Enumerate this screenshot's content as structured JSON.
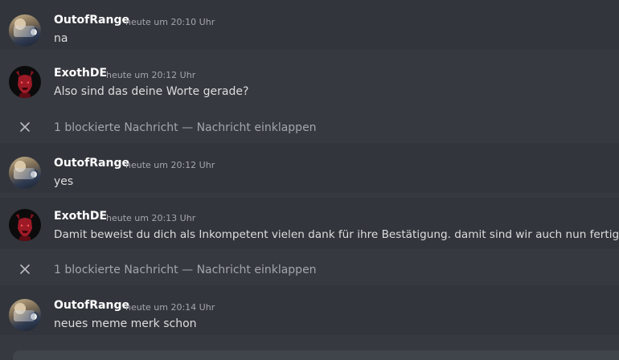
{
  "messages": [
    {
      "author": "OutofRange",
      "time": "heute um 20:10 Uhr",
      "text": "na"
    },
    {
      "author": "ExothDE",
      "time": "heute um 20:12 Uhr",
      "text": "Also sind das deine Worte gerade?"
    },
    {
      "author": "OutofRange",
      "time": "heute um 20:12 Uhr",
      "text": "yes"
    },
    {
      "author": "ExothDE",
      "time": "heute um 20:13 Uhr",
      "text": "Damit beweist du dich als Inkompetent vielen dank für ihre Bestätigung. damit sind wir auch nun fertig"
    },
    {
      "author": "OutofRange",
      "time": "heute um 20:14 Uhr",
      "text": "neues meme merk schon"
    }
  ],
  "blocked": [
    {
      "count_text": "1 blockierte Nachricht",
      "separator": " — ",
      "action": "Nachricht einklappen"
    },
    {
      "count_text": "1 blockierte Nachricht",
      "separator": " — ",
      "action": "Nachricht einklappen"
    }
  ],
  "icons": {
    "collapse": "close-icon"
  },
  "colors": {
    "background": "#36393f",
    "hover_row": "#32353b",
    "username": "#ffffff",
    "muted": "#a3a6aa"
  }
}
